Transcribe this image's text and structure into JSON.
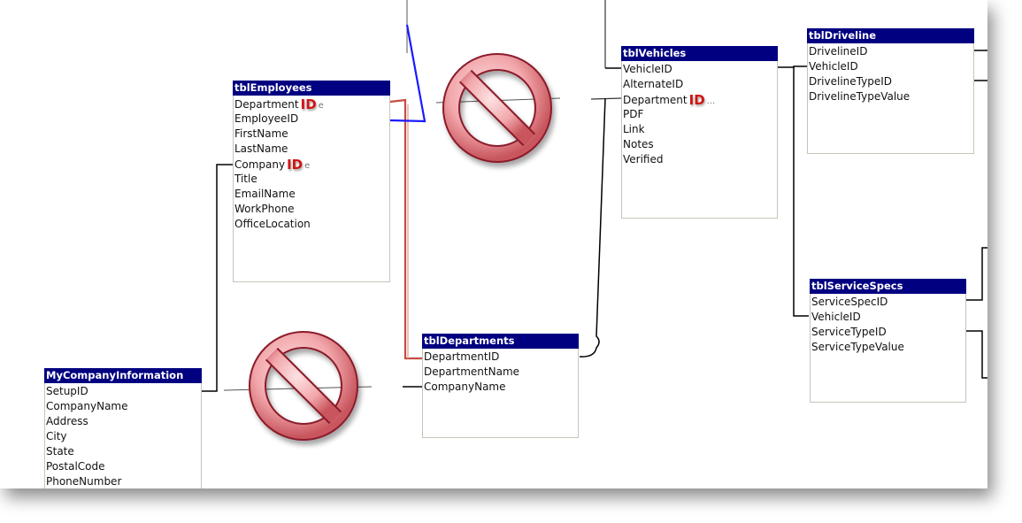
{
  "diagram": {
    "tables": [
      {
        "id": "tblEmployees",
        "title": "tblEmployees",
        "fields": [
          {
            "name": "Department",
            "overlay": "ID",
            "suffix": "e"
          },
          {
            "name": "EmployeeID"
          },
          {
            "name": "FirstName"
          },
          {
            "name": "LastName"
          },
          {
            "name": "Company",
            "overlay": "ID",
            "suffix": "e"
          },
          {
            "name": "Title"
          },
          {
            "name": "EmailName"
          },
          {
            "name": "WorkPhone"
          },
          {
            "name": "OfficeLocation"
          }
        ]
      },
      {
        "id": "tblVehicles",
        "title": "tblVehicles",
        "fields": [
          {
            "name": "VehicleID"
          },
          {
            "name": "AlternateID"
          },
          {
            "name": "Department",
            "overlay": "ID",
            "suffix": "..."
          },
          {
            "name": "PDF"
          },
          {
            "name": "Link"
          },
          {
            "name": "Notes"
          },
          {
            "name": "Verified"
          }
        ]
      },
      {
        "id": "tblDriveline",
        "title": "tblDriveline",
        "fields": [
          {
            "name": "DrivelineID"
          },
          {
            "name": "VehicleID"
          },
          {
            "name": "DrivelineTypeID"
          },
          {
            "name": "DrivelineTypeValue"
          }
        ]
      },
      {
        "id": "tblServiceSpecs",
        "title": "tblServiceSpecs",
        "fields": [
          {
            "name": "ServiceSpecID"
          },
          {
            "name": "VehicleID"
          },
          {
            "name": "ServiceTypeID"
          },
          {
            "name": "ServiceTypeValue"
          }
        ]
      },
      {
        "id": "tblDepartments",
        "title": "tblDepartments",
        "fields": [
          {
            "name": "DepartmentID"
          },
          {
            "name": "DepartmentName"
          },
          {
            "name": "CompanyName"
          }
        ]
      },
      {
        "id": "MyCompanyInformation",
        "title": "MyCompanyInformation",
        "fields": [
          {
            "name": "SetupID"
          },
          {
            "name": "CompanyName"
          },
          {
            "name": "Address"
          },
          {
            "name": "City"
          },
          {
            "name": "State"
          },
          {
            "name": "PostalCode"
          },
          {
            "name": "PhoneNumber"
          }
        ]
      }
    ],
    "relationships": [
      {
        "from": "tblEmployees.Department",
        "to": "tblDepartments.DepartmentID",
        "color": "#c0392b",
        "style": "annotated-red"
      },
      {
        "from": "tblEmployees.EmployeeID",
        "to": "tblVehicles.Department",
        "color": "#1a1aff",
        "style": "annotated-blue",
        "blocked": true
      },
      {
        "from": "MyCompanyInformation.SetupID",
        "to": "tblEmployees.Company",
        "color": "#000000"
      },
      {
        "from": "MyCompanyInformation.SetupID",
        "to": "tblDepartments.CompanyName",
        "color": "#000000",
        "blocked": true
      },
      {
        "from": "tblDepartments.DepartmentID",
        "to": "tblVehicles.Department",
        "color": "#000000"
      },
      {
        "from": "tblVehicles.VehicleID",
        "to": "tblDriveline.VehicleID",
        "color": "#000000"
      },
      {
        "from": "tblVehicles.VehicleID",
        "to": "tblServiceSpecs.VehicleID",
        "color": "#000000"
      }
    ],
    "annotations": {
      "no_sign_icon": "prohibited-sign",
      "no_sign_count": 2
    },
    "colors": {
      "title_bar": "#000080",
      "overlay_id": "#d01515",
      "red_line": "#c0392b",
      "blue_line": "#1a1aff",
      "no_sign_fill": "#f2a7ab",
      "no_sign_outline": "#8b1a2a"
    }
  }
}
